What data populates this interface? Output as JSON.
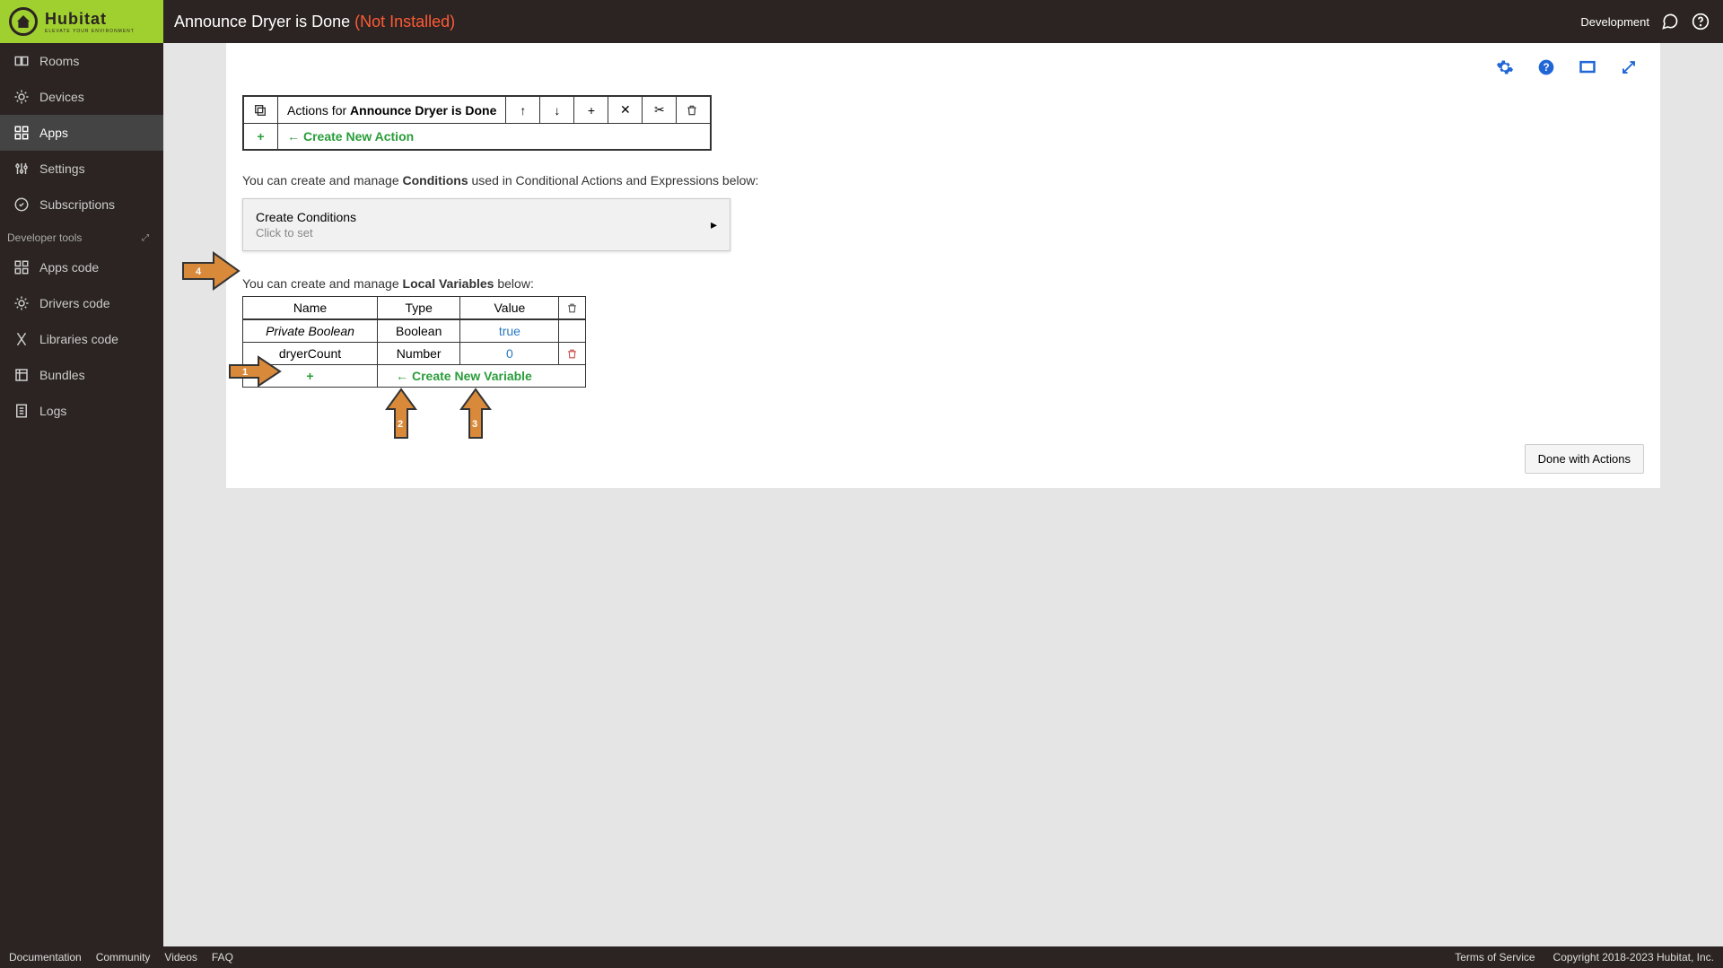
{
  "header": {
    "logo_main": "Hubitat",
    "logo_sub": "ELEVATE YOUR ENVIRONMENT",
    "title_prefix": "Announce Dryer is Done ",
    "title_status": "(Not Installed)",
    "right_label": "Development"
  },
  "sidebar": {
    "items_top": [
      {
        "label": "Rooms"
      },
      {
        "label": "Devices"
      },
      {
        "label": "Apps"
      },
      {
        "label": "Settings"
      },
      {
        "label": "Subscriptions"
      }
    ],
    "section_label": "Developer tools",
    "items_dev": [
      {
        "label": "Apps code"
      },
      {
        "label": "Drivers code"
      },
      {
        "label": "Libraries code"
      },
      {
        "label": "Bundles"
      },
      {
        "label": "Logs"
      }
    ]
  },
  "content": {
    "actions_prefix": "Actions for ",
    "actions_subject": "Announce Dryer is Done",
    "create_action_label": "Create New Action",
    "conditions_helper_pre": "You can create and manage ",
    "conditions_helper_bold": "Conditions",
    "conditions_helper_post": " used in Conditional Actions and Expressions below:",
    "conditions_box_title": "Create Conditions",
    "conditions_box_sub": "Click to set",
    "vars_helper_pre": "You can create and manage ",
    "vars_helper_bold": "Local Variables",
    "vars_helper_post": " below:",
    "var_cols": {
      "name": "Name",
      "type": "Type",
      "value": "Value"
    },
    "var_rows": [
      {
        "name": "Private Boolean",
        "type": "Boolean",
        "value": "true",
        "italic": true,
        "deletable": false
      },
      {
        "name": "dryerCount",
        "type": "Number",
        "value": "0",
        "italic": false,
        "deletable": true
      }
    ],
    "create_var_label": "Create New Variable",
    "done_label": "Done with Actions"
  },
  "footer": {
    "left": [
      "Documentation",
      "Community",
      "Videos",
      "FAQ"
    ],
    "right": [
      "Terms of Service",
      "Copyright 2018-2023 Hubitat, Inc."
    ]
  }
}
